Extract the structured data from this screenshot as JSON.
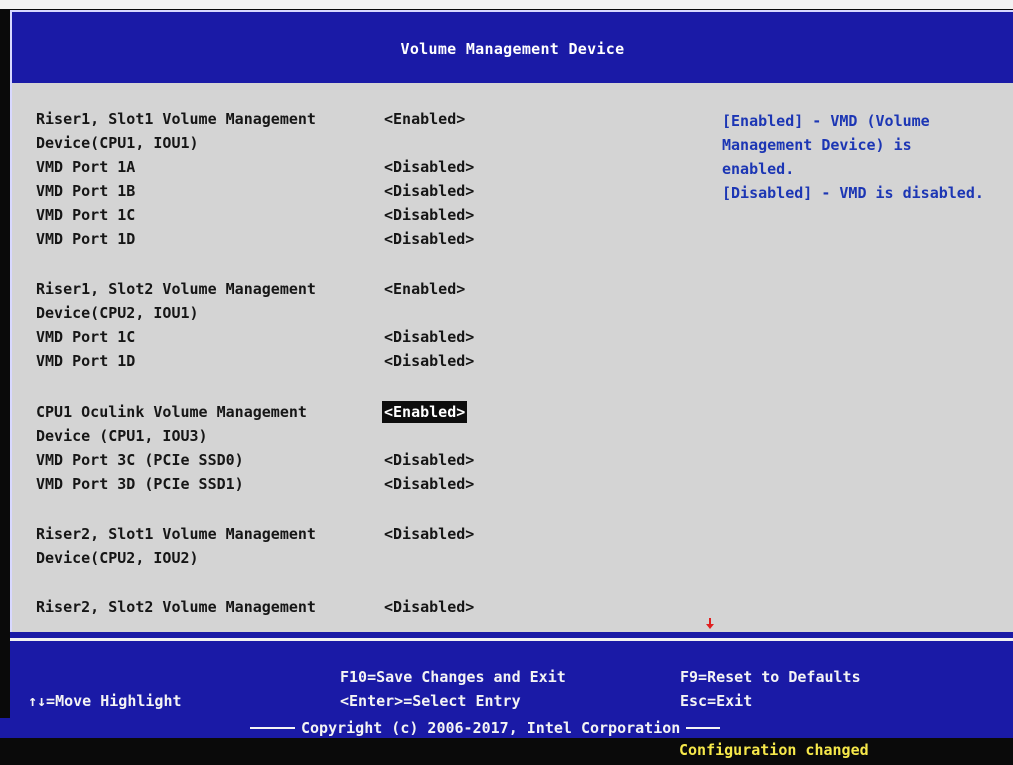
{
  "header": {
    "title": "Volume Management Device"
  },
  "settings": [
    {
      "label": "Riser1, Slot1 Volume Management",
      "value": "<Enabled>"
    },
    {
      "label": "Device(CPU1, IOU1)",
      "value": ""
    },
    {
      "label": "VMD Port 1A",
      "value": "<Disabled>"
    },
    {
      "label": "VMD Port 1B",
      "value": "<Disabled>"
    },
    {
      "label": "VMD Port 1C",
      "value": "<Disabled>"
    },
    {
      "label": "VMD Port 1D",
      "value": "<Disabled>"
    },
    {
      "label": "Riser1, Slot2 Volume Management",
      "value": "<Enabled>"
    },
    {
      "label": "Device(CPU2, IOU1)",
      "value": ""
    },
    {
      "label": "VMD Port 1C",
      "value": "<Disabled>"
    },
    {
      "label": "VMD Port 1D",
      "value": "<Disabled>"
    },
    {
      "label": "CPU1 Oculink Volume Management",
      "value": "<Enabled>"
    },
    {
      "label": "Device (CPU1, IOU3)",
      "value": ""
    },
    {
      "label": "VMD Port 3C (PCIe SSD0)",
      "value": "<Disabled>"
    },
    {
      "label": "VMD Port 3D (PCIe SSD1)",
      "value": "<Disabled>"
    },
    {
      "label": "Riser2, Slot1 Volume Management",
      "value": "<Disabled>"
    },
    {
      "label": "Device(CPU2, IOU2)",
      "value": ""
    },
    {
      "label": "Riser2, Slot2 Volume Management",
      "value": "<Disabled>"
    }
  ],
  "help": {
    "lines": [
      "[Enabled] - VMD (Volume",
      "Management Device) is",
      "enabled.",
      "[Disabled] - VMD is disabled."
    ]
  },
  "footer": {
    "save_exit": "F10=Save Changes and Exit",
    "select_entry": "<Enter>=Select Entry",
    "reset_defaults": "F9=Reset to Defaults",
    "exit": "Esc=Exit",
    "move_highlight": "↑↓=Move Highlight",
    "copyright": "Copyright (c) 2006-2017, Intel Corporation"
  },
  "status": {
    "message": "Configuration changed"
  },
  "colors": {
    "header_bg": "#1a1aa6",
    "main_bg": "#d4d4d4",
    "help_text": "#1c36b4",
    "status_text": "#f6e84a",
    "scroll_arrow": "#e02020"
  },
  "icons": {
    "scroll_indicator": "scroll-down-arrow-icon"
  }
}
